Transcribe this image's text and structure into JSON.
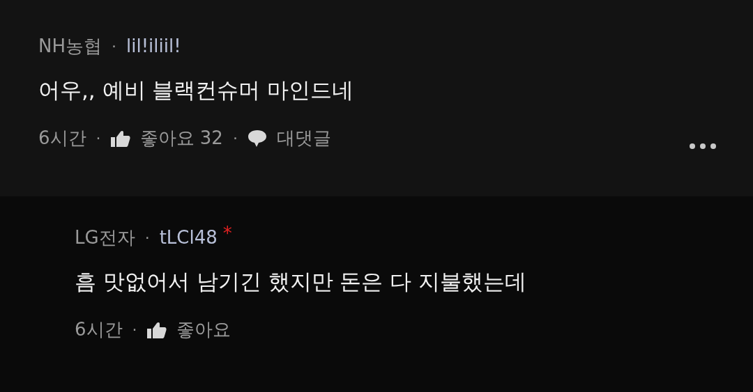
{
  "comments": [
    {
      "kind": "comment",
      "company": "NH농협",
      "sep": "·",
      "nickname": "lil!iliil!",
      "body": "어우,, 예비 블랙컨슈머 마인드네",
      "time": "6시간",
      "like_label": "좋아요",
      "like_count": "32",
      "reply_label": "대댓글",
      "menu": true
    },
    {
      "kind": "reply",
      "company": "LG전자",
      "sep": "·",
      "nickname": "tLCl48",
      "badge": "*",
      "body": "흠 맛없어서 남기긴 했지만 돈은 다 지불했는데",
      "time": "6시간",
      "like_label": "좋아요",
      "menu": false
    }
  ]
}
